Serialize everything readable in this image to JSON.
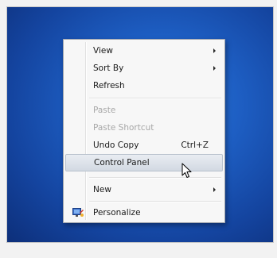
{
  "context_menu": {
    "items": [
      {
        "label": "View",
        "submenu": true,
        "disabled": false
      },
      {
        "label": "Sort By",
        "submenu": true,
        "disabled": false
      },
      {
        "label": "Refresh",
        "submenu": false,
        "disabled": false
      },
      {
        "label": "Paste",
        "submenu": false,
        "disabled": true
      },
      {
        "label": "Paste Shortcut",
        "submenu": false,
        "disabled": true
      },
      {
        "label": "Undo Copy",
        "shortcut": "Ctrl+Z",
        "submenu": false,
        "disabled": false
      },
      {
        "label": "Control Panel",
        "submenu": false,
        "disabled": false,
        "highlighted": true
      },
      {
        "label": "New",
        "submenu": true,
        "disabled": false
      },
      {
        "label": "Personalize",
        "icon": "personalize-icon",
        "submenu": false,
        "disabled": false
      }
    ]
  },
  "colors": {
    "desktop": "#1e5fc4",
    "menu_bg": "#f7f7f7",
    "highlight": "#d2d9e2",
    "disabled_text": "#a8a8a8"
  },
  "icons": {
    "personalize": "personalize-icon",
    "submenu": "chevron-right-icon",
    "cursor": "mouse-pointer-icon"
  }
}
